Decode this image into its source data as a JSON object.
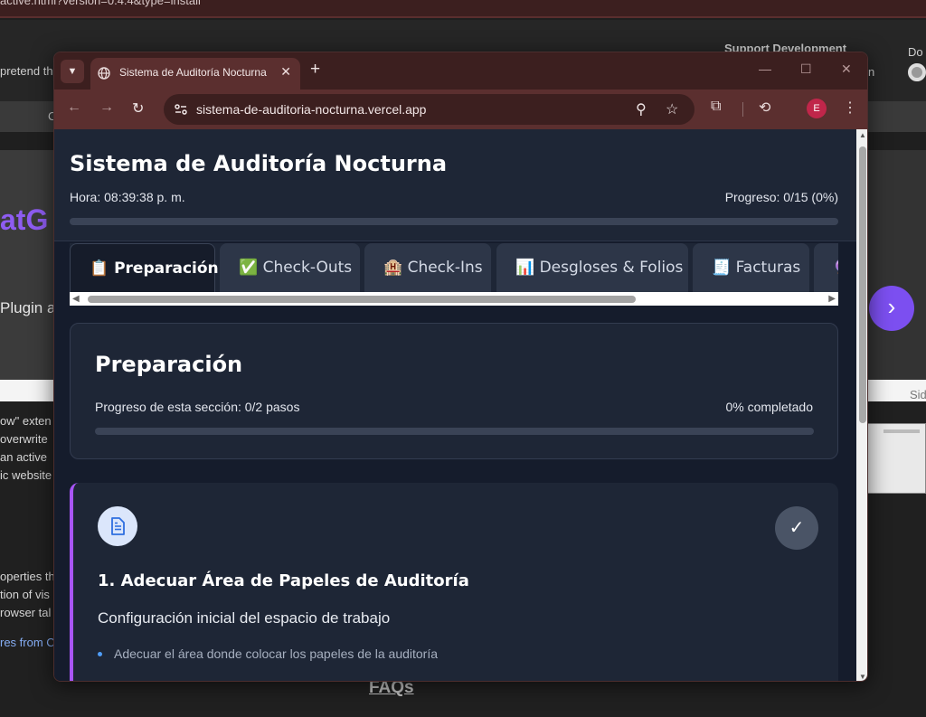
{
  "background_page": {
    "topbar_text": "active.html?version=0.4.4&type=install",
    "support_heading": "Support Development",
    "do_text": "Do",
    "n_text": "n",
    "pretend_text": "pretend th",
    "nav_c": "C",
    "logo_text": "atG",
    "plugin_text": "Plugin as",
    "sid_text": "Sid",
    "lines": [
      "ow\" exten",
      "overwrite",
      "an active",
      "ic website"
    ],
    "lines2": [
      "operties th",
      "tion of vis",
      "rowser tal"
    ],
    "link_text": "res from C",
    "faqs": "FAQs",
    "next_arrow": "›"
  },
  "browser": {
    "tab_title": "Sistema de Auditoría Nocturna",
    "tab_close": "✕",
    "new_tab": "+",
    "url": "sistema-de-auditoria-nocturna.vercel.app",
    "profile_initial": "E"
  },
  "app": {
    "title": "Sistema de Auditoría Nocturna",
    "time_label": "Hora: 08:39:38 p. m.",
    "progress_label": "Progreso: 0/15 (0%)",
    "progress_fraction": 0,
    "tabs": [
      {
        "icon": "📋",
        "label": "Preparación",
        "active": true
      },
      {
        "icon": "✅",
        "label": "Check-Outs",
        "active": false
      },
      {
        "icon": "🏨",
        "label": "Check-Ins",
        "active": false
      },
      {
        "icon": "📊",
        "label": "Desgloses & Folios",
        "active": false
      },
      {
        "icon": "🧾",
        "label": "Facturas",
        "active": false
      },
      {
        "icon": "🔮",
        "label": "",
        "active": false
      }
    ],
    "section": {
      "title": "Preparación",
      "progress_label": "Progreso de esta sección: 0/2 pasos",
      "percent_label": "0% completado",
      "progress_fraction": 0
    },
    "step": {
      "title": "1. Adecuar Área de Papeles de Auditoría",
      "subtitle": "Configuración inicial del espacio de trabajo",
      "bullets": [
        "Adecuar el área donde colocar los papeles de la auditoría"
      ],
      "check_glyph": "✓"
    }
  },
  "colors": {
    "accent": "#7c5cf5",
    "step_border": "#a855f7",
    "bullet": "#4f9df7",
    "browser_frame": "#5b2f2f"
  }
}
